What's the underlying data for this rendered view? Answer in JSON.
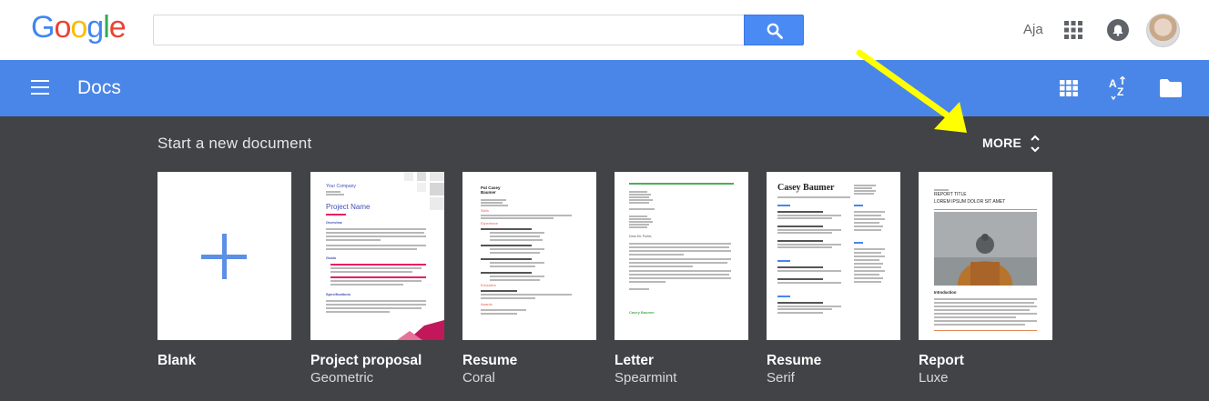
{
  "logo": {
    "letters": [
      "G",
      "o",
      "o",
      "g",
      "l",
      "e"
    ],
    "colors": [
      "#4285f4",
      "#ea4335",
      "#fbbc05",
      "#4285f4",
      "#34a853",
      "#ea4335"
    ]
  },
  "search": {
    "value": "",
    "placeholder": ""
  },
  "user": {
    "name": "Aja"
  },
  "app": {
    "title": "Docs"
  },
  "gallery": {
    "title": "Start a new document",
    "more_label": "MORE",
    "templates": [
      {
        "name": "Blank",
        "subtitle": ""
      },
      {
        "name": "Project proposal",
        "subtitle": "Geometric",
        "thumb": {
          "company": "Your Company",
          "heading": "Project Name",
          "sections": [
            "Overview",
            "Goals",
            "Specifications"
          ]
        }
      },
      {
        "name": "Resume",
        "subtitle": "Coral",
        "thumb": {
          "heading": "Pat Casey Baumer",
          "sections": [
            "Skills",
            "Experience",
            "Education",
            "Awards"
          ]
        }
      },
      {
        "name": "Letter",
        "subtitle": "Spearmint",
        "thumb": {
          "salutation": "Dear Mr. Porter,",
          "signature": "Casey Baumer"
        }
      },
      {
        "name": "Resume",
        "subtitle": "Serif",
        "thumb": {
          "heading": "Casey Baumer"
        }
      },
      {
        "name": "Report",
        "subtitle": "Luxe",
        "thumb": {
          "kicker": "REPORT TITLE",
          "heading": "LOREM IPSUM DOLOR SIT AMET",
          "section": "Introduction"
        }
      }
    ]
  },
  "colors": {
    "accent": "#4a86e8",
    "gallery_bg": "#424346",
    "arrow": "#ffff00",
    "coral": "#e8604c",
    "spearmint": "#4caf50"
  }
}
